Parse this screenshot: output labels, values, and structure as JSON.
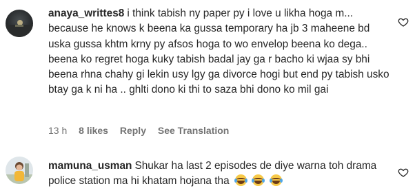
{
  "comments": [
    {
      "username": "anaya_writtes8",
      "text": "i think tabish ny paper py i love u likha hoga m... because he knows k beena ka gussa temporary ha jb 3 maheene bd uska gussa khtm krny py afsos hoga to wo envelop beena ko dega.. beena ko regret hoga kuky tabish badal jay ga r bacho ki wjaa sy bhi beena rhna chahy gi lekin usy lgy ga divorce hogi but end py tabish usko btay ga k ni ha .. ghlti dono ki thi to saza bhi dono ko mil gai",
      "time": "13 h",
      "likes": "8 likes",
      "reply_label": "Reply",
      "translation_label": "See Translation",
      "avatar_icon": "avatar-photo-dark-landscape",
      "like_icon": "heart-outline-icon"
    },
    {
      "username": "mamuna_usman",
      "text": "Shukar ha last 2 episodes de diye warna toh drama police station ma hi khatam hojana tha",
      "emoji_text": "😂😂😂",
      "avatar_icon": "avatar-photo-child",
      "like_icon": "heart-outline-icon"
    }
  ],
  "colors": {
    "text": "#262626",
    "meta": "#737373"
  }
}
